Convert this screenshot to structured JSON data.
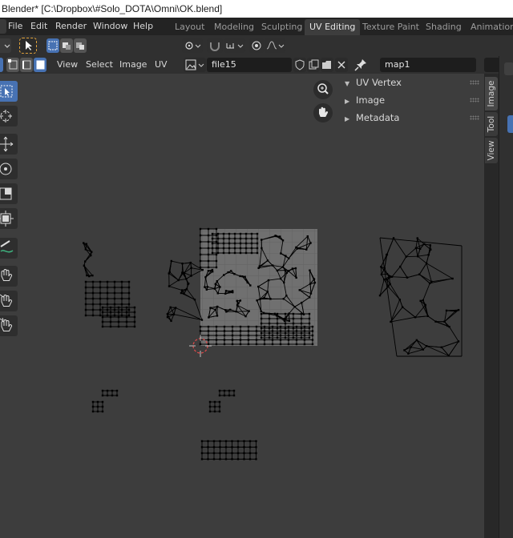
{
  "window": {
    "title": "Blender* [C:\\Dropbox\\#Solo_DOTA\\Omni\\OK.blend]"
  },
  "menubar": {
    "items": [
      "File",
      "Edit",
      "Render",
      "Window",
      "Help"
    ]
  },
  "workspaces": {
    "tabs": [
      "Layout",
      "Modeling",
      "Sculpting",
      "UV Editing",
      "Texture Paint",
      "Shading",
      "Animation"
    ],
    "active": "UV Editing"
  },
  "uv_header": {
    "menus": [
      "View",
      "Select",
      "Image",
      "UV"
    ],
    "image_name": "file15",
    "uv_map": "map1"
  },
  "npanel": {
    "sections": [
      {
        "label": "UV Vertex",
        "expanded": true
      },
      {
        "label": "Image",
        "expanded": false
      },
      {
        "label": "Metadata",
        "expanded": false
      }
    ]
  },
  "sidebar_tabs": [
    "Image",
    "Tool",
    "View"
  ],
  "active_sidebar_tab": "Image",
  "tools": [
    "select-box",
    "cursor",
    "move",
    "rotate",
    "scale",
    "transform",
    "annotate",
    "grab",
    "relax",
    "pinch"
  ],
  "active_tool": "select-box",
  "colors": {
    "accent": "#4772b3",
    "uv_wire": "#000000",
    "viewport_bg": "#3d3d3d",
    "texture_grid": "#6f6f6f",
    "cursor": "#d44a4a"
  }
}
